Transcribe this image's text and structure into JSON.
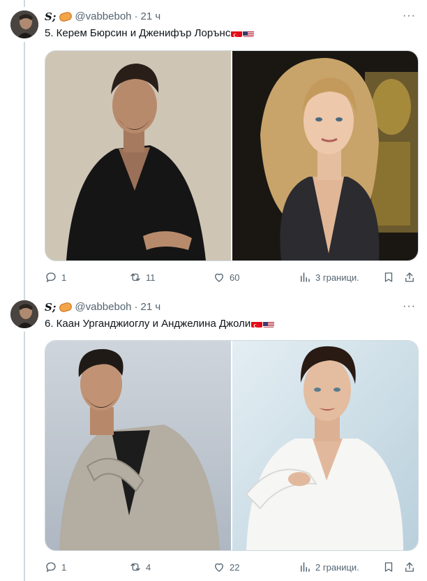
{
  "tweets": [
    {
      "display_name": "S;",
      "handle": "@vabbeboh",
      "separator": "·",
      "time": "21 ч",
      "more": "···",
      "text": "5. Керем Бюрсин и Дженифър Лорънс",
      "replies": "1",
      "retweets": "11",
      "likes": "60",
      "views": "3 граници."
    },
    {
      "display_name": "S;",
      "handle": "@vabbeboh",
      "separator": "·",
      "time": "21 ч",
      "more": "···",
      "text": "6. Каан Урганджиоглу и Анджелина Джоли",
      "replies": "1",
      "retweets": "4",
      "likes": "22",
      "views": "2 граници."
    }
  ],
  "icons": {
    "reply": "reply-icon",
    "retweet": "retweet-icon",
    "like": "heart-icon",
    "views": "views-icon",
    "bookmark": "bookmark-icon",
    "share": "share-icon"
  },
  "colors": {
    "muted": "#536471",
    "border": "#cfd9de",
    "text": "#0f1419"
  }
}
